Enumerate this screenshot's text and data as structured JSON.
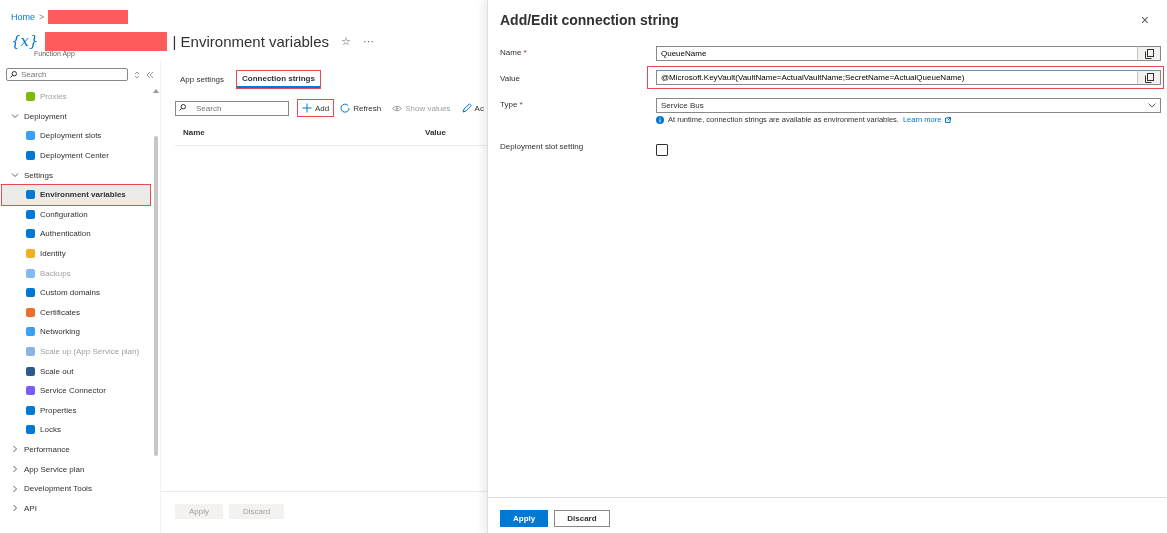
{
  "breadcrumb": [
    {
      "label": "Home"
    },
    {
      "label": ">"
    }
  ],
  "header": {
    "icon_text": "{x}",
    "title": "| Environment variables",
    "subtitle": "Function App",
    "favorite": "☆",
    "more": "···"
  },
  "sidebar": {
    "search": {
      "placeholder": "Search"
    },
    "items": [
      {
        "kind": "item",
        "label": "Proxies",
        "disabled": true,
        "selected": false
      },
      {
        "kind": "section",
        "label": "Deployment",
        "expanded": true,
        "children": [
          {
            "label": "Deployment slots",
            "disabled": false,
            "selected": false
          },
          {
            "label": "Deployment Center",
            "disabled": false,
            "selected": false
          }
        ]
      },
      {
        "kind": "section",
        "label": "Settings",
        "expanded": true,
        "children": [
          {
            "label": "Environment variables",
            "disabled": false,
            "selected": true,
            "highlighted": true
          },
          {
            "label": "Configuration",
            "disabled": false,
            "selected": false
          },
          {
            "label": "Authentication",
            "disabled": false,
            "selected": false
          },
          {
            "label": "Identity",
            "disabled": false,
            "selected": false
          },
          {
            "label": "Backups",
            "disabled": true,
            "selected": false
          },
          {
            "label": "Custom domains",
            "disabled": false,
            "selected": false
          },
          {
            "label": "Certificates",
            "disabled": false,
            "selected": false
          },
          {
            "label": "Networking",
            "disabled": false,
            "selected": false
          },
          {
            "label": "Scale up (App Service plan)",
            "disabled": true,
            "selected": false
          },
          {
            "label": "Scale out",
            "disabled": false,
            "selected": false
          },
          {
            "label": "Service Connector",
            "disabled": false,
            "selected": false
          },
          {
            "label": "Properties",
            "disabled": false,
            "selected": false
          },
          {
            "label": "Locks",
            "disabled": false,
            "selected": false
          }
        ]
      },
      {
        "kind": "section",
        "label": "Performance",
        "expanded": false
      },
      {
        "kind": "section",
        "label": "App Service plan",
        "expanded": false
      },
      {
        "kind": "section",
        "label": "Development Tools",
        "expanded": false
      },
      {
        "kind": "section",
        "label": "API",
        "expanded": false
      }
    ]
  },
  "tabs": [
    {
      "label": "App settings",
      "selected": false,
      "highlighted": false
    },
    {
      "label": "Connection strings",
      "selected": true,
      "highlighted": true
    }
  ],
  "toolbar": {
    "search": {
      "placeholder": "Search"
    },
    "buttons": [
      {
        "label": "Add",
        "disabled": false,
        "highlighted": true
      },
      {
        "label": "Refresh",
        "disabled": false,
        "highlighted": false
      },
      {
        "label": "Show values",
        "disabled": true,
        "highlighted": false
      },
      {
        "label": "Ac",
        "disabled": false,
        "highlighted": false
      }
    ]
  },
  "table": {
    "columns": [
      "Name",
      "Value"
    ]
  },
  "footer_buttons": [
    {
      "label": "Apply",
      "disabled": true
    },
    {
      "label": "Discard",
      "disabled": true
    }
  ],
  "panel": {
    "title": "Add/Edit connection string",
    "close": "×",
    "fields": [
      {
        "kind": "text",
        "label": "Name",
        "required_mark": "*",
        "value": "QueueName",
        "highlighted": false
      },
      {
        "kind": "text",
        "label": "Value",
        "value": "@Microsoft.KeyVault(VaultName=ActualVaultName;SecretName=ActualQueueName)",
        "highlighted": true
      },
      {
        "kind": "select",
        "label": "Type",
        "required_mark": "*",
        "value": "Service Bus",
        "highlighted": false,
        "info": "At runtime, connection strings are available as environment variables.",
        "link": "Learn more"
      },
      {
        "kind": "checkbox",
        "label": "Deployment slot setting",
        "checked": false,
        "highlighted": false
      }
    ],
    "buttons": [
      {
        "label": "Apply",
        "primary": true
      },
      {
        "label": "Discard",
        "primary": false
      }
    ]
  }
}
